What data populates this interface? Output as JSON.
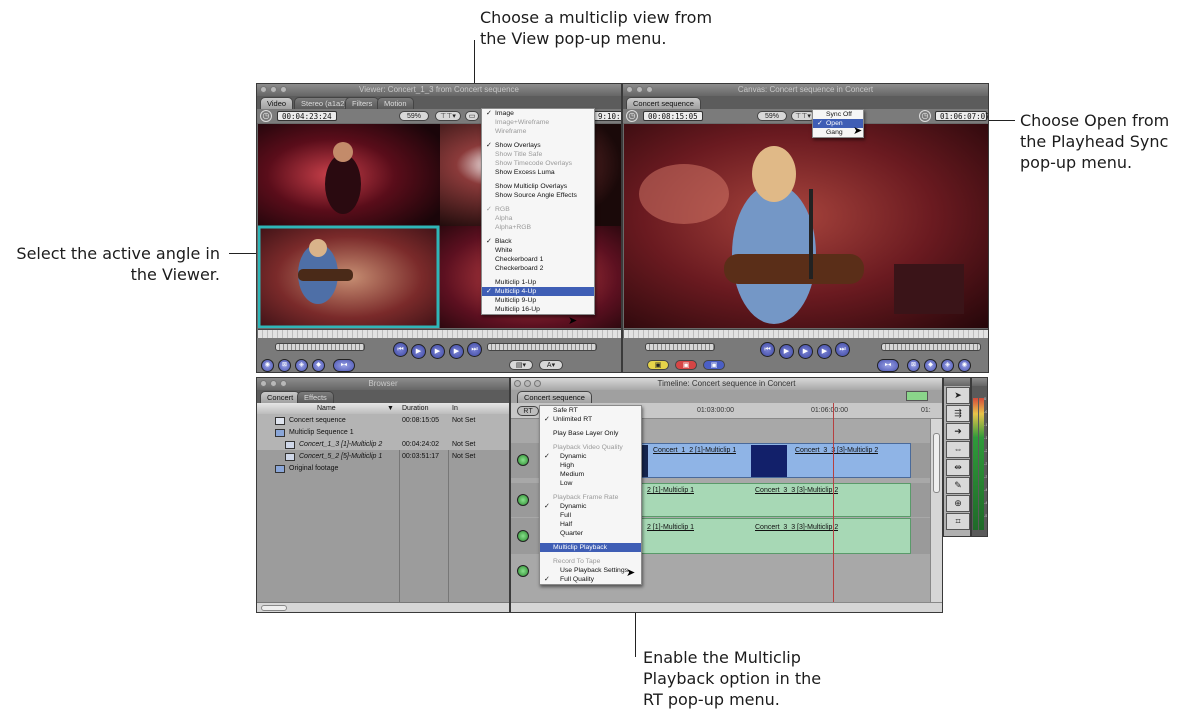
{
  "callouts": {
    "view_menu": [
      "Choose a multiclip view from",
      "the View pop-up menu."
    ],
    "playhead_sync": [
      "Choose Open from",
      "the Playhead Sync",
      "pop-up menu."
    ],
    "active_angle": [
      "Select the active angle in",
      "the Viewer."
    ],
    "multiclip_playback": [
      "Enable the Multiclip",
      "Playback option in the",
      "RT pop-up menu."
    ]
  },
  "viewer": {
    "title": "Viewer: Concert_1_3 from Concert sequence",
    "tabs": [
      "Video",
      "Stereo (a1a2)",
      "Filters",
      "Motion"
    ],
    "timecode_left": "00:04:23:24",
    "zoom": "59%",
    "timecode_right": "9:10:04",
    "view_menu": {
      "items": [
        {
          "label": "Image",
          "check": "✓",
          "state": "normal"
        },
        {
          "label": "Image+Wireframe",
          "check": "",
          "state": "dis"
        },
        {
          "label": "Wireframe",
          "check": "",
          "state": "dis"
        },
        {
          "sep": true
        },
        {
          "label": "Show Overlays",
          "check": "✓",
          "state": "normal"
        },
        {
          "label": "Show Title Safe",
          "check": "",
          "state": "dis"
        },
        {
          "label": "Show Timecode Overlays",
          "check": "",
          "state": "dis"
        },
        {
          "label": "Show Excess Luma",
          "check": "",
          "state": "normal"
        },
        {
          "sep": true
        },
        {
          "label": "Show Multiclip Overlays",
          "check": "",
          "state": "normal"
        },
        {
          "label": "Show Source Angle Effects",
          "check": "",
          "state": "normal"
        },
        {
          "sep": true
        },
        {
          "label": "RGB",
          "check": "✓",
          "state": "dis"
        },
        {
          "label": "Alpha",
          "check": "",
          "state": "dis"
        },
        {
          "label": "Alpha+RGB",
          "check": "",
          "state": "dis"
        },
        {
          "sep": true
        },
        {
          "label": "Black",
          "check": "✓",
          "state": "normal"
        },
        {
          "label": "White",
          "check": "",
          "state": "normal"
        },
        {
          "label": "Checkerboard 1",
          "check": "",
          "state": "normal"
        },
        {
          "label": "Checkerboard 2",
          "check": "",
          "state": "normal"
        },
        {
          "sep": true
        },
        {
          "label": "Multiclip 1-Up",
          "check": "",
          "state": "normal"
        },
        {
          "label": "Multiclip 4-Up",
          "check": "✓",
          "state": "hl"
        },
        {
          "label": "Multiclip 9-Up",
          "check": "",
          "state": "normal"
        },
        {
          "label": "Multiclip 16-Up",
          "check": "",
          "state": "normal"
        }
      ]
    }
  },
  "canvas": {
    "title": "Canvas: Concert sequence in Concert",
    "tab": "Concert sequence",
    "timecode_left": "00:08:15:05",
    "zoom": "59%",
    "timecode_right": "01:06:07:07",
    "sync_menu": {
      "items": [
        {
          "label": "Sync Off",
          "check": "",
          "state": "normal"
        },
        {
          "label": "Open",
          "check": "✓",
          "state": "hl"
        },
        {
          "label": "Gang",
          "check": "",
          "state": "normal"
        }
      ]
    }
  },
  "browser": {
    "title": "Browser",
    "tabs": [
      "Concert",
      "Effects"
    ],
    "columns": [
      "Name",
      "Duration",
      "In"
    ],
    "rows": [
      {
        "name": "Concert sequence",
        "duration": "00:08:15:05",
        "in": "Not Set",
        "indent": 0,
        "italic": false
      },
      {
        "name": "Multiclip Sequence 1",
        "duration": "",
        "in": "",
        "indent": 0,
        "italic": false
      },
      {
        "name": "Concert_1_3 [1]-Multiclip 2",
        "duration": "00:04:24:02",
        "in": "Not Set",
        "indent": 1,
        "italic": true
      },
      {
        "name": "Concert_5_2 [5]-Multiclip 1",
        "duration": "00:03:51:17",
        "in": "Not Set",
        "indent": 1,
        "italic": true
      },
      {
        "name": "Original footage",
        "duration": "",
        "in": "",
        "indent": 0,
        "italic": false
      }
    ]
  },
  "timeline": {
    "title": "Timeline: Concert sequence in Concert",
    "tab": "Concert sequence",
    "rt_button": "RT",
    "ruler": [
      "01:03:00:00",
      "01:06:00:00",
      "01:"
    ],
    "clips": {
      "v1a": "Concert_1_2 [1]-Multiclip 1",
      "v1b": "Concert_3_3 [3]-Multiclip 2",
      "a1a": "2 [1]-Multiclip 1",
      "a1b": "Concert_3_3 [3]-Multiclip 2",
      "a2a": "2 [1]-Multiclip 1",
      "a2b": "Concert_3_3 [3]-Multiclip 2"
    },
    "rt_menu": {
      "items": [
        {
          "label": "Safe RT",
          "check": "",
          "state": "normal",
          "sub": false
        },
        {
          "label": "Unlimited RT",
          "check": "✓",
          "state": "normal",
          "sub": false
        },
        {
          "sep": true
        },
        {
          "label": "Play Base Layer Only",
          "check": "",
          "state": "normal",
          "sub": false
        },
        {
          "sep": true
        },
        {
          "label": "Playback Video Quality",
          "check": "",
          "state": "sec",
          "sub": false
        },
        {
          "label": "Dynamic",
          "check": "✓",
          "state": "normal",
          "sub": true
        },
        {
          "label": "High",
          "check": "",
          "state": "normal",
          "sub": true
        },
        {
          "label": "Medium",
          "check": "",
          "state": "normal",
          "sub": true
        },
        {
          "label": "Low",
          "check": "",
          "state": "normal",
          "sub": true
        },
        {
          "sep": true
        },
        {
          "label": "Playback Frame Rate",
          "check": "",
          "state": "sec",
          "sub": false
        },
        {
          "label": "Dynamic",
          "check": "✓",
          "state": "normal",
          "sub": true
        },
        {
          "label": "Full",
          "check": "",
          "state": "normal",
          "sub": true
        },
        {
          "label": "Half",
          "check": "",
          "state": "normal",
          "sub": true
        },
        {
          "label": "Quarter",
          "check": "",
          "state": "normal",
          "sub": true
        },
        {
          "sep": true
        },
        {
          "label": "Multiclip Playback",
          "check": "",
          "state": "hl",
          "sub": false
        },
        {
          "sep": true
        },
        {
          "label": "Record To Tape",
          "check": "",
          "state": "sec",
          "sub": false
        },
        {
          "label": "Use Playback Settings",
          "check": "",
          "state": "normal",
          "sub": true
        },
        {
          "label": "Full Quality",
          "check": "✓",
          "state": "normal",
          "sub": true
        }
      ]
    }
  },
  "audio_meter": {
    "scale": [
      "0",
      "-6",
      "-12",
      "-18",
      "-24",
      "-30",
      "-36",
      "-42",
      "-48",
      "-54"
    ]
  }
}
